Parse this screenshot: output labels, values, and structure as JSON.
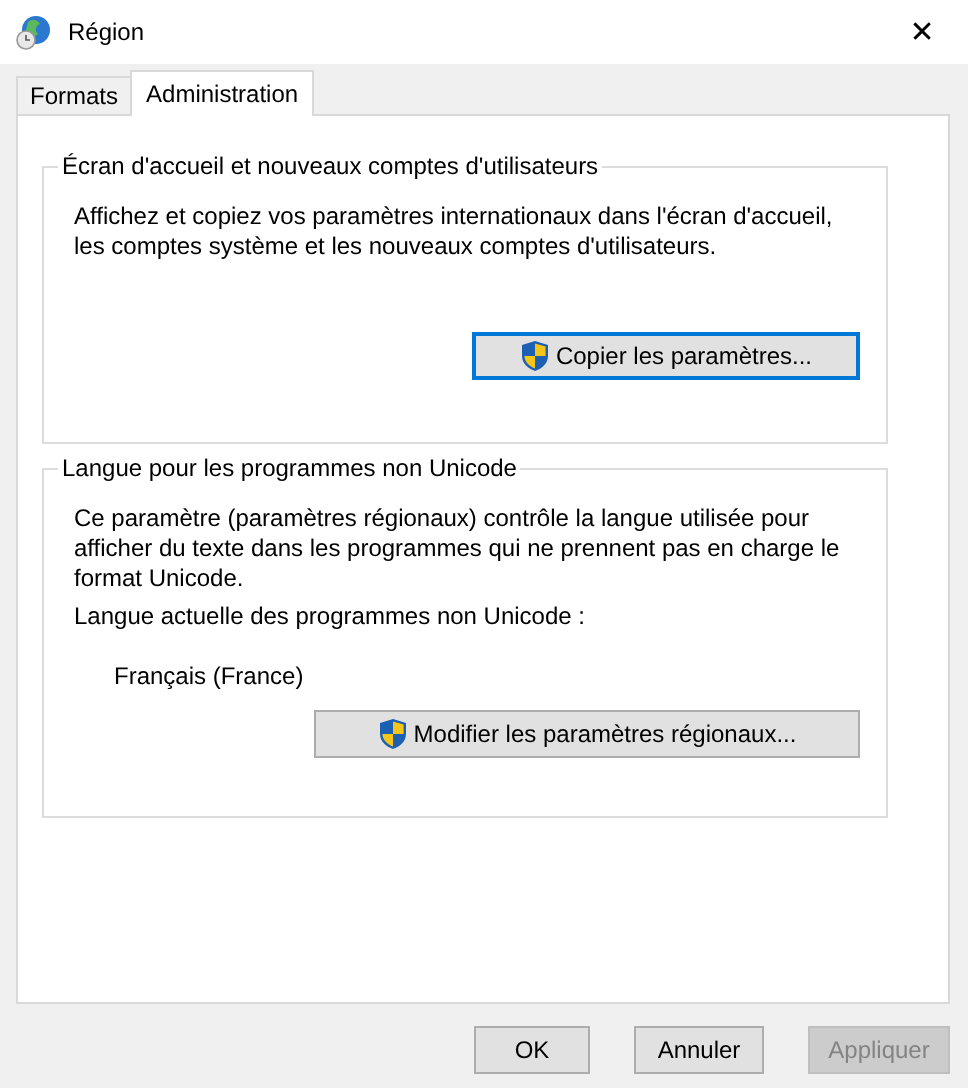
{
  "window": {
    "title": "Région",
    "close": "✕"
  },
  "tabs": [
    {
      "label": "Formats",
      "selected": false
    },
    {
      "label": "Administration",
      "selected": true
    }
  ],
  "groups": [
    {
      "title": "Écran d'accueil et nouveaux comptes d'utilisateurs",
      "text_lines": [
        "Affichez et copiez vos paramètres internationaux dans l'écran d'accueil,",
        "les comptes système et les nouveaux comptes d'utilisateurs."
      ],
      "button": {
        "label": "Copier les paramètres...",
        "focused": true
      }
    },
    {
      "title": "Langue pour les programmes non Unicode",
      "text_lines": [
        "Ce paramètre (paramètres régionaux) contrôle la langue utilisée pour",
        "afficher du texte dans les programmes qui ne prennent pas en charge le",
        "format Unicode."
      ],
      "current_label": "Langue actuelle des programmes non Unicode :",
      "current_value": "Français (France)",
      "button": {
        "label": "Modifier les paramètres régionaux...",
        "focused": false
      }
    }
  ],
  "buttons": [
    {
      "label": "OK",
      "disabled": false
    },
    {
      "label": "Annuler",
      "disabled": false
    },
    {
      "label": "Appliquer",
      "disabled": true
    }
  ]
}
